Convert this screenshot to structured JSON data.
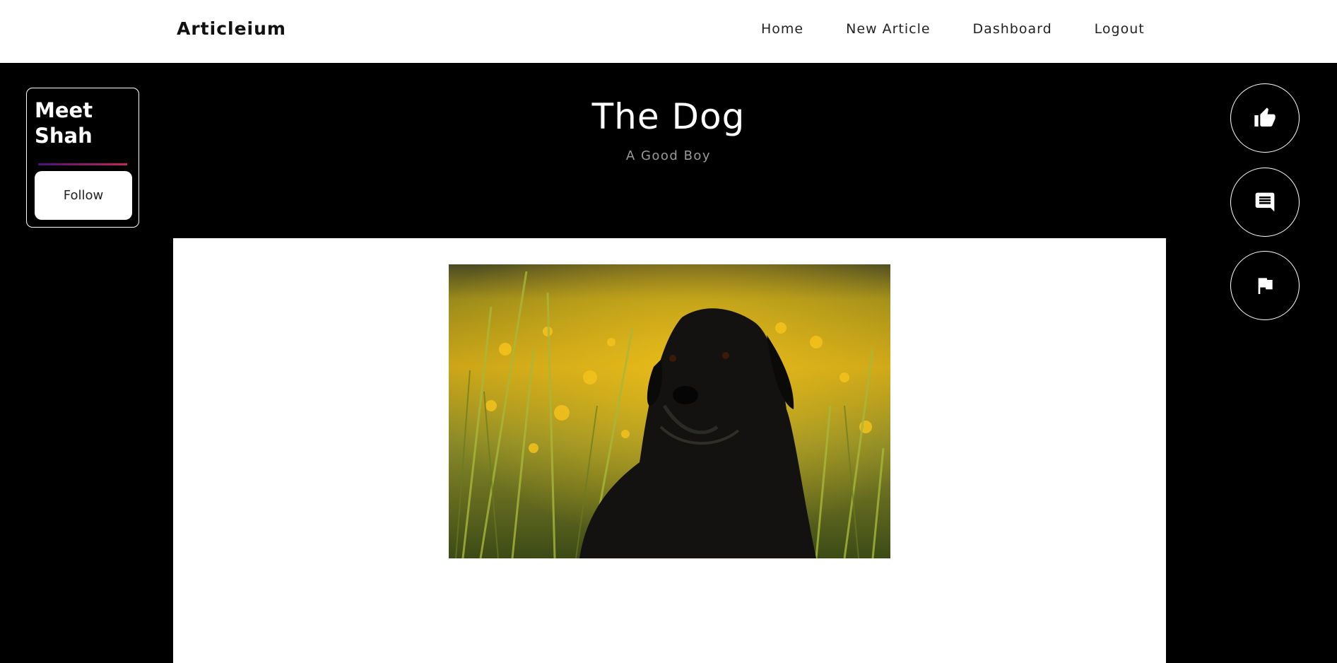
{
  "navbar": {
    "brand": "Articleium",
    "links": [
      "Home",
      "New Article",
      "Dashboard",
      "Logout"
    ]
  },
  "article": {
    "title": "The Dog",
    "subtitle": "A Good Boy",
    "image_icon": "dog-photo"
  },
  "author": {
    "name_line1": "Meet",
    "name_line2": "Shah",
    "follow_label": "Follow"
  },
  "actions": [
    {
      "icon": "thumbs-up-icon"
    },
    {
      "icon": "comment-icon"
    },
    {
      "icon": "flag-icon"
    }
  ],
  "colors": {
    "background": "#000000",
    "navbar": "#ffffff",
    "accent_gradient_start": "#4a1178",
    "accent_gradient_end": "#c2275a"
  }
}
